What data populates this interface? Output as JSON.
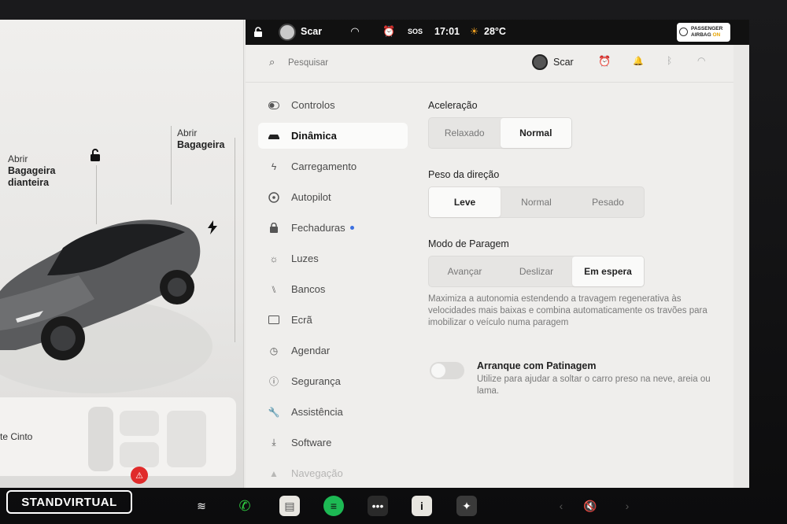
{
  "statusbar": {
    "user": "Scar",
    "time": "17:01",
    "temperature": "28°C",
    "sos": "SOS",
    "airbag_line1": "PASSENGER",
    "airbag_line2": "AIRBAG",
    "airbag_state": "ON"
  },
  "car": {
    "front_trunk_label_1": "Abrir",
    "front_trunk_label_2": "Bagageira",
    "front_trunk_label_3": "dianteira",
    "rear_trunk_label_1": "Abrir",
    "rear_trunk_label_2": "Bagageira",
    "seatbelt_label": "te Cinto"
  },
  "header": {
    "search_placeholder": "Pesquisar",
    "user": "Scar"
  },
  "menu": [
    {
      "label": "Controlos",
      "icon": "toggle-icon"
    },
    {
      "label": "Dinâmica",
      "icon": "car-icon",
      "active": true
    },
    {
      "label": "Carregamento",
      "icon": "bolt-icon"
    },
    {
      "label": "Autopilot",
      "icon": "steering-wheel-icon"
    },
    {
      "label": "Fechaduras",
      "icon": "lock-icon"
    },
    {
      "label": "Luzes",
      "icon": "light-icon"
    },
    {
      "label": "Bancos",
      "icon": "seat-icon"
    },
    {
      "label": "Ecrã",
      "icon": "display-icon"
    },
    {
      "label": "Agendar",
      "icon": "clock-icon"
    },
    {
      "label": "Segurança",
      "icon": "shield-icon"
    },
    {
      "label": "Assistência",
      "icon": "wrench-icon"
    },
    {
      "label": "Software",
      "icon": "download-icon"
    },
    {
      "label": "Navegação",
      "icon": "navigation-icon"
    }
  ],
  "content": {
    "acceleration": {
      "title": "Aceleração",
      "options": [
        "Relaxado",
        "Normal"
      ],
      "selected": "Normal"
    },
    "steering": {
      "title": "Peso da direção",
      "options": [
        "Leve",
        "Normal",
        "Pesado"
      ],
      "selected": "Leve"
    },
    "stopping": {
      "title": "Modo de Paragem",
      "options": [
        "Avançar",
        "Deslizar",
        "Em espera"
      ],
      "selected": "Em espera",
      "description": "Maximiza a autonomia estendendo a travagem regenerativa às velocidades mais baixas e combina automaticamente os travões para imobilizar o veículo numa paragem"
    },
    "slip_start": {
      "title": "Arranque com Patinagem",
      "description": "Utilize para ajudar a soltar o carro preso na neve, areia ou lama.",
      "enabled": false
    }
  },
  "watermark": "STANDVIRTUAL",
  "colors": {
    "accent_orange": "#f0a020",
    "spotify_green": "#1db954",
    "phone_green": "#2ecc40",
    "seatbelt_red": "#e02b2b",
    "lock_blue_dot": "#3b6fe0"
  }
}
